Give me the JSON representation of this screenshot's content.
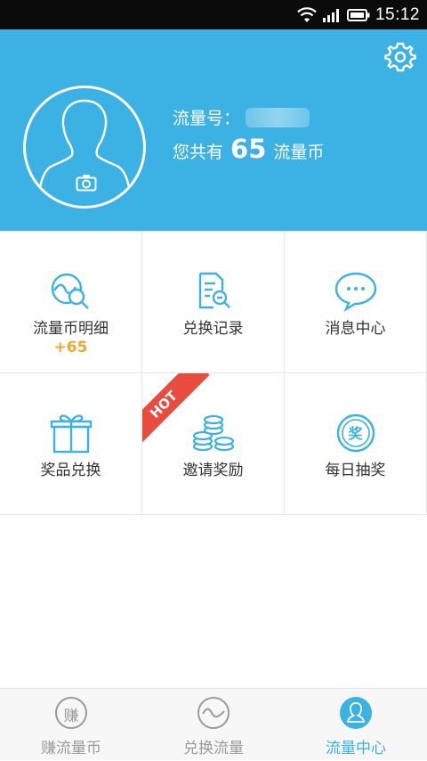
{
  "status_bar": {
    "time": "15:12"
  },
  "header": {
    "uid_label": "流量号：",
    "coins_prefix": "您共有",
    "coins_value": "65",
    "coins_unit": "流量币"
  },
  "grid": {
    "items": [
      {
        "label": "流量币明细",
        "badge": "+65",
        "icon": "coin-detail-search-icon"
      },
      {
        "label": "兑换记录",
        "icon": "document-search-icon"
      },
      {
        "label": "消息中心",
        "icon": "chat-bubble-icon"
      },
      {
        "label": "奖品兑换",
        "icon": "gift-icon"
      },
      {
        "label": "邀请奖励",
        "badge": "HOT",
        "icon": "coin-stack-icon"
      },
      {
        "label": "每日抽奖",
        "icon": "lottery-icon",
        "icon_text": "奖"
      }
    ]
  },
  "bottom_nav": {
    "tabs": [
      {
        "label": "赚流量币",
        "icon_text": "赚",
        "active": false
      },
      {
        "label": "兑换流量",
        "active": false
      },
      {
        "label": "流量中心",
        "active": true
      }
    ]
  },
  "colors": {
    "brand_blue": "#3cb2e4",
    "accent_orange": "#f0a830",
    "hot_red": "#e84c3d",
    "inactive_gray": "#9a9a9a"
  }
}
